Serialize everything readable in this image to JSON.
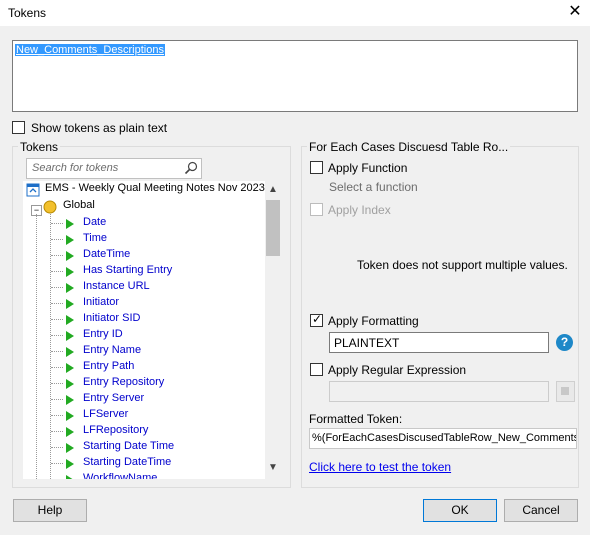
{
  "window": {
    "title": "Tokens",
    "close_glyph": "✕"
  },
  "editor": {
    "content": "New_Comments_Descriptions"
  },
  "options": {
    "show_plain_text_label": "Show tokens as plain text",
    "show_plain_text_checked": false
  },
  "tokens_panel": {
    "legend": "Tokens",
    "search_placeholder": "Search for tokens",
    "root": "EMS - Weekly Qual Meeting Notes Nov 2023",
    "group": "Global",
    "items": [
      "Date",
      "Time",
      "DateTime",
      "Has Starting Entry",
      "Instance URL",
      "Initiator",
      "Initiator SID",
      "Entry ID",
      "Entry Name",
      "Entry Path",
      "Entry Repository",
      "Entry Server",
      "LFServer",
      "LFRepository",
      "Starting Date Time",
      "Starting DateTime",
      "WorkflowName"
    ]
  },
  "right_panel": {
    "legend": "For Each Cases Discuesd Table Ro...",
    "apply_function_label": "Apply Function",
    "apply_function_checked": false,
    "select_function_text": "Select a function",
    "apply_index_label": "Apply Index",
    "apply_index_checked": false,
    "multi_values_note": "Token does not support multiple values.",
    "apply_formatting_label": "Apply Formatting",
    "apply_formatting_checked": true,
    "format_value": "PLAINTEXT",
    "help_glyph": "?",
    "apply_regex_label": "Apply Regular Expression",
    "apply_regex_checked": false,
    "regex_value": "",
    "formatted_token_label": "Formatted Token:",
    "formatted_token_value": "%(ForEachCasesDiscusedTableRow_New_Comments",
    "test_link": "Click here to test the token"
  },
  "buttons": {
    "help": "Help",
    "ok": "OK",
    "cancel": "Cancel"
  },
  "colors": {
    "accent": "#0078d7",
    "selection": "#3399ff",
    "token_text": "#0000cc",
    "token_icon": "#22aa22",
    "help_icon": "#1e88c8"
  }
}
